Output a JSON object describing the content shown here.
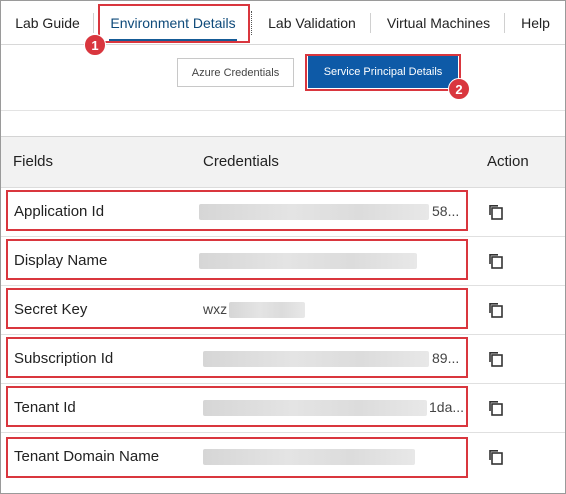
{
  "tabs": [
    {
      "label": "Lab Guide"
    },
    {
      "label": "Environment Details"
    },
    {
      "label": "Lab Validation"
    },
    {
      "label": "Virtual Machines"
    },
    {
      "label": "Help"
    }
  ],
  "annotations": {
    "badge1": "1",
    "badge2": "2"
  },
  "subtabs": {
    "azure": "Azure Credentials",
    "service_principal": "Service Principal Details"
  },
  "table": {
    "headers": {
      "fields": "Fields",
      "credentials": "Credentials",
      "action": "Action"
    },
    "rows": [
      {
        "field": "Application Id",
        "value_visible": "58..."
      },
      {
        "field": "Display Name",
        "value_visible": ""
      },
      {
        "field": "Secret Key",
        "value_visible": "wxz"
      },
      {
        "field": "Subscription Id",
        "value_visible": "89..."
      },
      {
        "field": "Tenant Id",
        "value_visible": "1da..."
      },
      {
        "field": "Tenant Domain Name",
        "value_visible": ""
      }
    ]
  },
  "icons": {
    "copy": "copy-icon"
  },
  "colors": {
    "accent": "#0e5aa7",
    "highlight": "#d9363e",
    "active_tab_text": "#0e4a7a"
  }
}
